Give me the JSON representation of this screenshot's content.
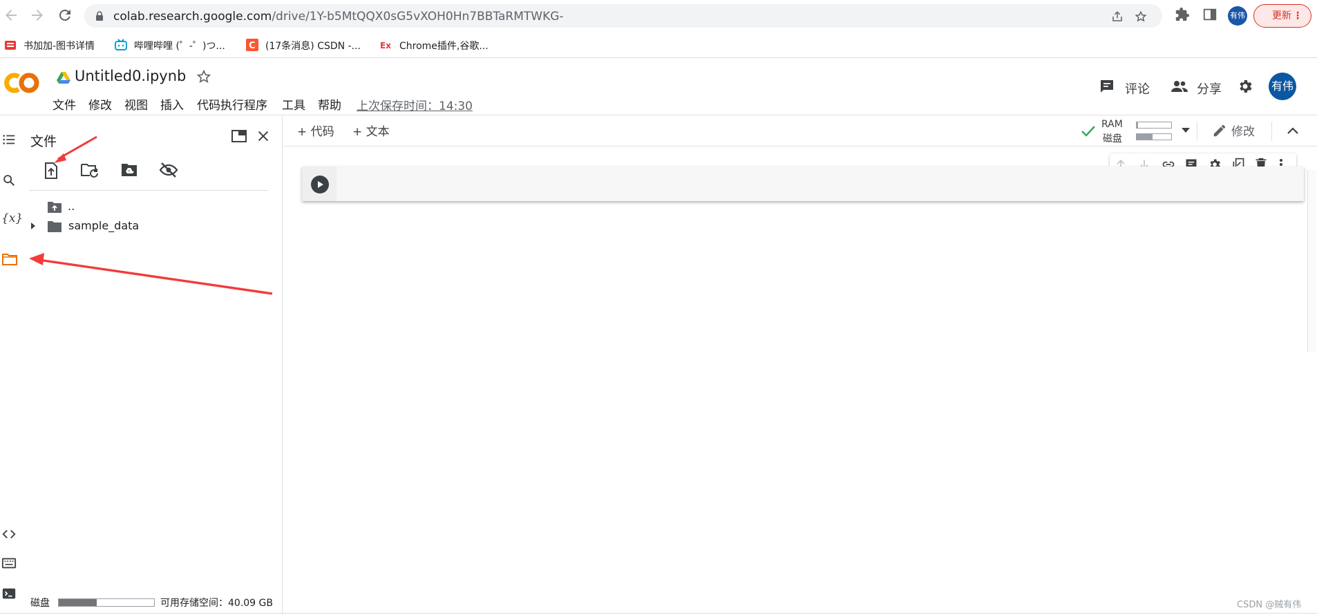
{
  "browser": {
    "url_host": "colab.research.google.com",
    "url_path": "/drive/1Y-b5MtQQX0sG5vXOH0Hn7BBTaRMTWKG-",
    "profile_label": "有伟",
    "update_label": "更新",
    "bookmarks": [
      {
        "label": "书加加-图书详情",
        "icon": "bookjiajia-icon"
      },
      {
        "label": "哔哩哔哩 (゜-゜)つ...",
        "icon": "bilibili-icon"
      },
      {
        "label": "(17条消息) CSDN -...",
        "icon": "csdn-icon"
      },
      {
        "label": "Chrome插件,谷歌...",
        "icon": "chrome-ext-icon"
      }
    ]
  },
  "colab": {
    "notebook_title": "Untitled0.ipynb",
    "menu": [
      "文件",
      "修改",
      "视图",
      "插入",
      "代码执行程序",
      "工具",
      "帮助"
    ],
    "save_status": "上次保存时间：14:30",
    "comment_label": "评论",
    "share_label": "分享",
    "avatar_label": "有伟"
  },
  "toolbar": {
    "add_code": "+ 代码",
    "add_text": "+ 文本",
    "ram_label": "RAM",
    "disk_label": "磁盘",
    "ram_fraction": 0.04,
    "disk_fraction": 0.45,
    "edit_label": "修改"
  },
  "files_panel": {
    "title": "文件",
    "parent_label": "..",
    "folders": [
      "sample_data"
    ],
    "disk_label": "磁盘",
    "disk_fraction": 0.4,
    "free_space_label": "可用存储空间：40.09 GB"
  },
  "watermark": "CSDN @贼有伟",
  "colors": {
    "accent_orange": "#e8710a",
    "annotation_red": "#f23b3b",
    "avatar_blue": "#0b57a3",
    "update_red": "#d93025"
  }
}
